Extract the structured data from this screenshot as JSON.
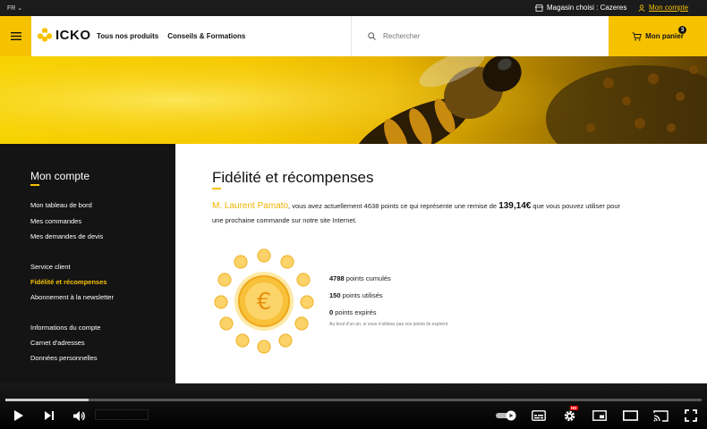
{
  "topbar": {
    "lang": "FR",
    "store_label": "Magasin choisi : Cazeres",
    "account_label": "Mon compte"
  },
  "header": {
    "logo_text": "ICKO",
    "nav": [
      "Tous nos produits",
      "Conseils & Formations"
    ],
    "search_placeholder": "Rechercher",
    "cart_label": "Mon panier",
    "cart_count": "3"
  },
  "sidebar": {
    "title": "Mon compte",
    "groups": [
      [
        "Mon tableau de bord",
        "Mes commandes",
        "Mes demandes de devis"
      ],
      [
        "Service client",
        "Fidélité et récompenses",
        "Abonnement à la newsletter"
      ],
      [
        "Informations du compte",
        "Carnet d'adresses",
        "Données personnelles"
      ]
    ],
    "active": "Fidélité et récompenses"
  },
  "main": {
    "title": "Fidélité et récompenses",
    "customer_name": "M. Laurent Pamato",
    "intro_part1": ", vous avez actuellement 4638 points ce qui représente une remise de ",
    "discount": "139,14€",
    "intro_part2": " que vous pouvez utiliser pour une prochaine commande sur notre site Internet.",
    "stats": [
      {
        "value": "4788",
        "label": " points cumulés"
      },
      {
        "value": "150",
        "label": " points utilisés"
      },
      {
        "value": "0",
        "label": " points expirés"
      }
    ],
    "note": "Au bout d'un an, si vous n'utilisez pas vos points ils expirent"
  },
  "player": {
    "progress": 0.12,
    "hd_badge": "HD",
    "icons": [
      "play-icon",
      "next-icon",
      "volume-icon",
      "autoplay-toggle-icon",
      "subtitles-icon",
      "settings-icon",
      "miniplayer-icon",
      "theater-icon",
      "cast-icon",
      "fullscreen-icon"
    ]
  },
  "colors": {
    "accent": "#f6c200",
    "dark": "#141414"
  }
}
